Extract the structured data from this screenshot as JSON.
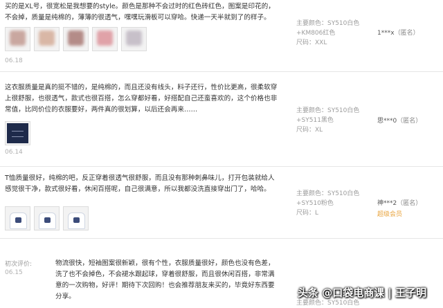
{
  "reviews": [
    {
      "content": "买的是XL号，很宽松是我想要的style。颜色是那种不会过时的红色砖红色，图案是印花的，不会掉，质量是纯棉的，薄薄的很透气，嘿嘿玩滑板可以穿哈。快递一天半就到了的样子。",
      "date": "06.18",
      "spec_color_label": "主要颜色：SY510白色",
      "spec_color_extra": "+KM806红色",
      "spec_size": "尺码：XXL",
      "user": "1***x",
      "anon": "（匿名）",
      "thumb_colors": [
        "#c9a7a0",
        "#d9b7a6",
        "#b48c88",
        "#e0a2a8",
        "#c7c0c9"
      ]
    },
    {
      "content": "这衣服质量是真的挺不错的，是纯棉的，而且还没有线头，料子还行，性价比更高，很柔软穿上很舒服，也很透气，款式也很百搭，怎么穿都好看，好搭配自己还蛮喜欢的，这个价格也非常值，比同价位的衣服要好，两件真的很划算，以后还会再来……",
      "date": "06.14",
      "spec_color_label": "主要颜色：SY510白色",
      "spec_color_extra": "+SY511黑色",
      "spec_size": "尺码：XL",
      "user": "思***0",
      "anon": "（匿名）"
    },
    {
      "content": "T恤质量很好，纯棉的吧，反正穿着很透气很舒服，而且没有那种刺鼻味儿，打开包装就给人感觉很干净，款式很好看，休闲百搭呢，自己很满意，所以我都没洗直接穿出门了，哈哈。",
      "spec_color_label": "主要颜色：SY510白色",
      "spec_color_extra": "+SY510粉色",
      "spec_size": "尺码：L",
      "user": "神***2",
      "anon": "（匿名）",
      "vip": "超级会员"
    },
    {
      "label": "初次评价:",
      "date": "06.15",
      "content": "物流很快，短袖图案很新颖，很有个性，衣服质量很好，颜色也没有色差，洗了也不会掉色，不会褪水跟起球，穿着很舒服，而且很休闲百搭，非常满意的一次购物，好评！期待下次回购！也会推荐朋友来买的，毕竟好东西要分享。",
      "spec_color_label": "主要颜色：SY510白色"
    }
  ],
  "watermark": "头条 @口袋电商课 | 王子明"
}
